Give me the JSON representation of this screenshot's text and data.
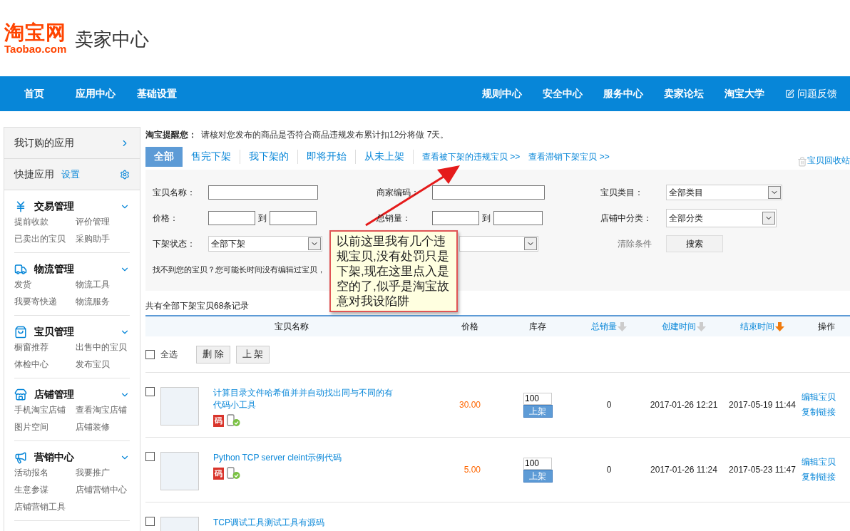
{
  "header": {
    "logo_cn": "淘宝网",
    "logo_en": "Taobao.com",
    "title": "卖家中心"
  },
  "nav": {
    "left": [
      "首页",
      "应用中心",
      "基础设置"
    ],
    "right": [
      "规则中心",
      "安全中心",
      "服务中心",
      "卖家论坛",
      "淘宝大学"
    ],
    "feedback": "问题反馈"
  },
  "sidebar": {
    "subscribed": "我订购的应用",
    "quick": "快捷应用",
    "quick_link": "设置",
    "sections": [
      {
        "title": "交易管理",
        "kind": "yen",
        "expanded": true,
        "links": [
          "提前收款",
          "评价管理",
          "已卖出的宝贝",
          "采购助手"
        ]
      },
      {
        "title": "物流管理",
        "kind": "truck",
        "expanded": true,
        "links": [
          "发货",
          "物流工具",
          "我要寄快递",
          "物流服务"
        ]
      },
      {
        "title": "宝贝管理",
        "kind": "bag",
        "expanded": true,
        "links": [
          "橱窗推荐",
          "出售中的宝贝",
          "体检中心",
          "发布宝贝"
        ]
      },
      {
        "title": "店铺管理",
        "kind": "store",
        "expanded": true,
        "links": [
          "手机淘宝店铺",
          "查看淘宝店铺",
          "图片空间",
          "店铺装修"
        ]
      },
      {
        "title": "营销中心",
        "kind": "megaphone",
        "expanded": true,
        "links": [
          "活动报名",
          "我要推广",
          "生意参谋",
          "店铺营销中心",
          "店铺营销工具"
        ]
      }
    ]
  },
  "notice": {
    "label": "淘宝提醒您：",
    "text": "请核对您发布的商品是否符合商品违规发布累计扣12分将做 7天。"
  },
  "tabs": [
    {
      "label": "全部",
      "selected": true
    },
    {
      "label": "售完下架",
      "selected": false
    },
    {
      "label": "我下架的",
      "selected": false
    },
    {
      "label": "即将开始",
      "selected": false
    },
    {
      "label": "从未上架",
      "selected": false
    }
  ],
  "links": [
    "查看被下架的违规宝贝 >>",
    "查看滞销下架宝贝 >>"
  ],
  "recycle": "宝贝回收站",
  "filters": {
    "name_label": "宝贝名称：",
    "code_label": "商家编码：",
    "category_label": "宝贝类目：",
    "category_value": "全部类目",
    "price_label": "价格：",
    "to": "到",
    "to2": "到",
    "sales_label": "总销量：",
    "shop_category_label": "店铺中分类：",
    "shop_category_value": "全部分类",
    "status_label": "下架状态：",
    "status_value": "全部下架",
    "clear": "清除条件",
    "search": "搜索",
    "hint": "找不到您的宝贝？您可能长时间没有编辑过宝贝，"
  },
  "annotation": "以前这里我有几个违规宝贝,没有处罚只是下架,现在这里点入是空的了,似乎是淘宝故意对我设陷阱",
  "summary": "共有全部下架宝贝68条记录",
  "columns": [
    {
      "label": "宝贝名称",
      "sortable": false,
      "sorted": false
    },
    {
      "label": "价格",
      "sortable": false,
      "sorted": false
    },
    {
      "label": "库存",
      "sortable": false,
      "sorted": false
    },
    {
      "label": "总销量",
      "sortable": true,
      "sorted": false
    },
    {
      "label": "创建时间",
      "sortable": true,
      "sorted": false
    },
    {
      "label": "结束时间",
      "sortable": true,
      "sorted": true
    },
    {
      "label": "操作",
      "sortable": false,
      "sorted": false
    }
  ],
  "bulk": {
    "select_all": "全选",
    "checked": false,
    "buttons": [
      "删 除",
      "上 架"
    ]
  },
  "rows": [
    {
      "checked": false,
      "title": "计算目录文件哈希值并并自动找出同与不同的有代码小工具",
      "badge": "码",
      "price": "30.00",
      "stock": "100",
      "relist": "上架",
      "sales": "0",
      "created": "2017-01-26 12:21",
      "ended": "2017-05-19 11:44",
      "actions": [
        "编辑宝贝",
        "复制链接"
      ]
    },
    {
      "checked": false,
      "title": "Python TCP server cleint示例代码",
      "badge": "码",
      "price": "5.00",
      "stock": "100",
      "relist": "上架",
      "sales": "0",
      "created": "2017-01-26 11:24",
      "ended": "2017-05-23 11:47",
      "actions": [
        "编辑宝贝",
        "复制链接"
      ]
    },
    {
      "checked": false,
      "title": "TCP调试工具测试工具有源码"
    }
  ]
}
